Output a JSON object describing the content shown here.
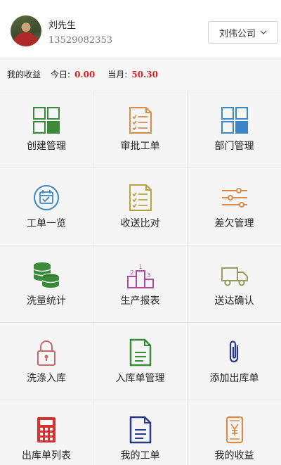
{
  "user": {
    "name": "刘先生",
    "phone": "13529082353"
  },
  "company": {
    "selected": "刘伟公司"
  },
  "earnings": {
    "title": "我的收益",
    "today_label": "今日:",
    "today_value": "0.00",
    "month_label": "当月:",
    "month_value": "50.30"
  },
  "menu": [
    {
      "label": "创建管理",
      "icon": "grid-icon"
    },
    {
      "label": "审批工单",
      "icon": "checklist-icon"
    },
    {
      "label": "部门管理",
      "icon": "grid-icon"
    },
    {
      "label": "工单一览",
      "icon": "calendar-check-icon"
    },
    {
      "label": "收送比对",
      "icon": "checklist-icon"
    },
    {
      "label": "差欠管理",
      "icon": "sliders-icon"
    },
    {
      "label": "洗量统计",
      "icon": "coins-icon"
    },
    {
      "label": "生产报表",
      "icon": "podium-icon"
    },
    {
      "label": "送达确认",
      "icon": "truck-icon"
    },
    {
      "label": "洗涤入库",
      "icon": "lock-icon"
    },
    {
      "label": "入库单管理",
      "icon": "document-icon"
    },
    {
      "label": "添加出库单",
      "icon": "paperclip-icon"
    },
    {
      "label": "出库单列表",
      "icon": "calculator-icon"
    },
    {
      "label": "我的工单",
      "icon": "document-icon"
    },
    {
      "label": "我的收益",
      "icon": "yen-phone-icon"
    }
  ],
  "colors": {
    "green": "#3a8a3a",
    "orange": "#d98c4a",
    "blue": "#3a86c8",
    "olive": "#b8a23a",
    "red": "#e02020"
  }
}
